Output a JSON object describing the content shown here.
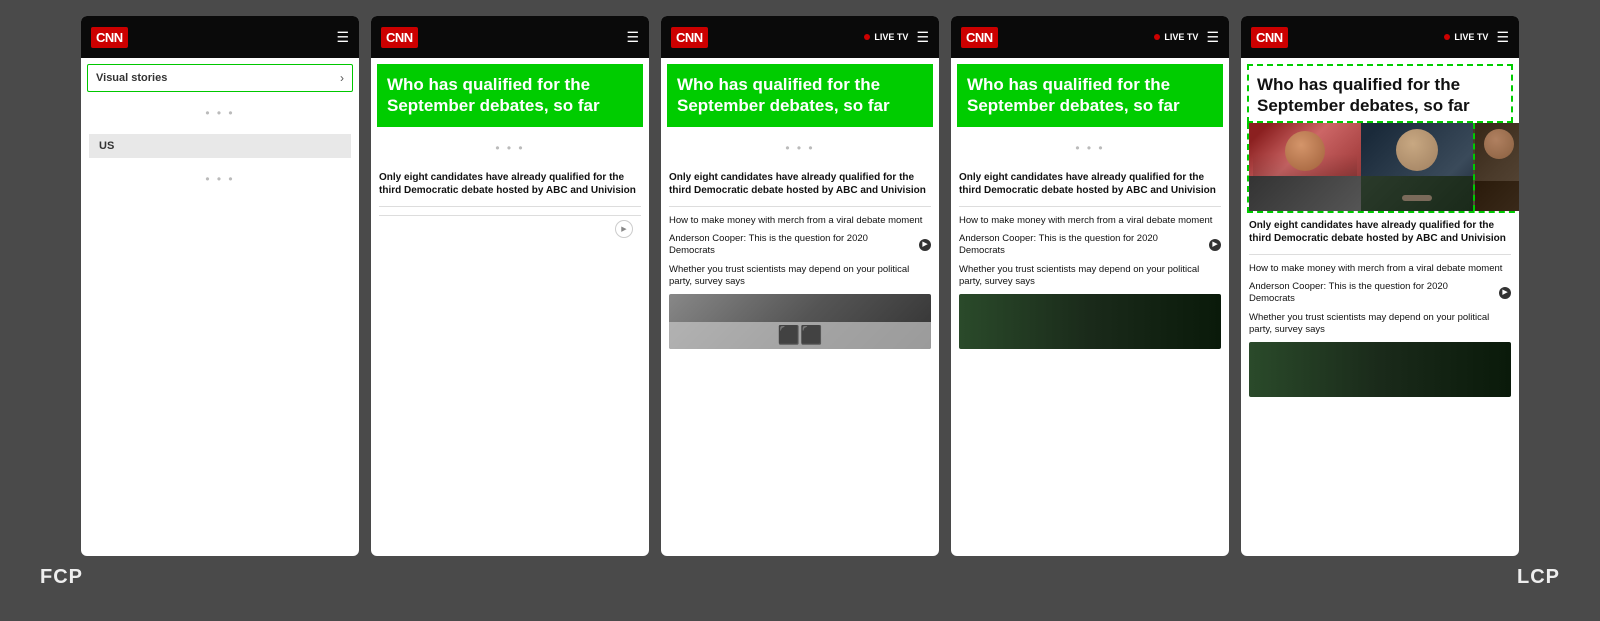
{
  "background_color": "#4a4a4a",
  "labels": {
    "fcp": "FCP",
    "lcp": "LCP"
  },
  "phones": [
    {
      "id": "phone-1",
      "type": "fcp-start",
      "header": {
        "logo": "CNN",
        "live_tv": false,
        "show_hamburger": true
      },
      "visual_stories_label": "Visual stories",
      "us_section": "US",
      "dots": "• • •"
    },
    {
      "id": "phone-2",
      "type": "article",
      "header": {
        "logo": "CNN",
        "live_tv": false,
        "show_hamburger": true
      },
      "headline": "Who has qualified for the September debates, so far",
      "main_article": "Only eight candidates have already qualified for the third Democratic debate hosted by ABC and Univision",
      "has_scroll_indicator": true
    },
    {
      "id": "phone-3",
      "type": "article-more",
      "header": {
        "logo": "CNN",
        "live_tv": true,
        "show_hamburger": true
      },
      "headline": "Who has qualified for the September debates, so far",
      "main_article": "Only eight candidates have already qualified for the third Democratic debate hosted by ABC and Univision",
      "sub_articles": [
        "How to make money with merch from a viral debate moment",
        "Anderson Cooper: This is the question for 2020 Democrats",
        "Whether you trust scientists may depend on your political party, survey says"
      ],
      "has_video_thumb": true
    },
    {
      "id": "phone-4",
      "type": "article-more",
      "header": {
        "logo": "CNN",
        "live_tv": true,
        "show_hamburger": true
      },
      "headline": "Who has qualified for the September debates, so far",
      "main_article": "Only eight candidates have already qualified for the third Democratic debate hosted by ABC and Univision",
      "sub_articles": [
        "How to make money with merch from a viral debate moment",
        "Anderson Cooper: This is the question for 2020 Democrats",
        "Whether you trust scientists may depend on your political party, survey says"
      ],
      "has_image_thumb": true
    },
    {
      "id": "phone-5",
      "type": "lcp",
      "header": {
        "logo": "CNN",
        "live_tv": true,
        "show_hamburger": true
      },
      "headline": "Who has qualified for the September debates, so far",
      "has_hero_image": true,
      "main_article": "Only eight candidates have already qualified for the third Democratic debate hosted by ABC and Univision",
      "sub_articles": [
        "How to make money with merch from a viral debate moment",
        "Anderson Cooper: This is the question for 2020 Democrats",
        "Whether you trust scientists may depend on your political party, survey says"
      ],
      "has_image_thumb": true
    }
  ]
}
